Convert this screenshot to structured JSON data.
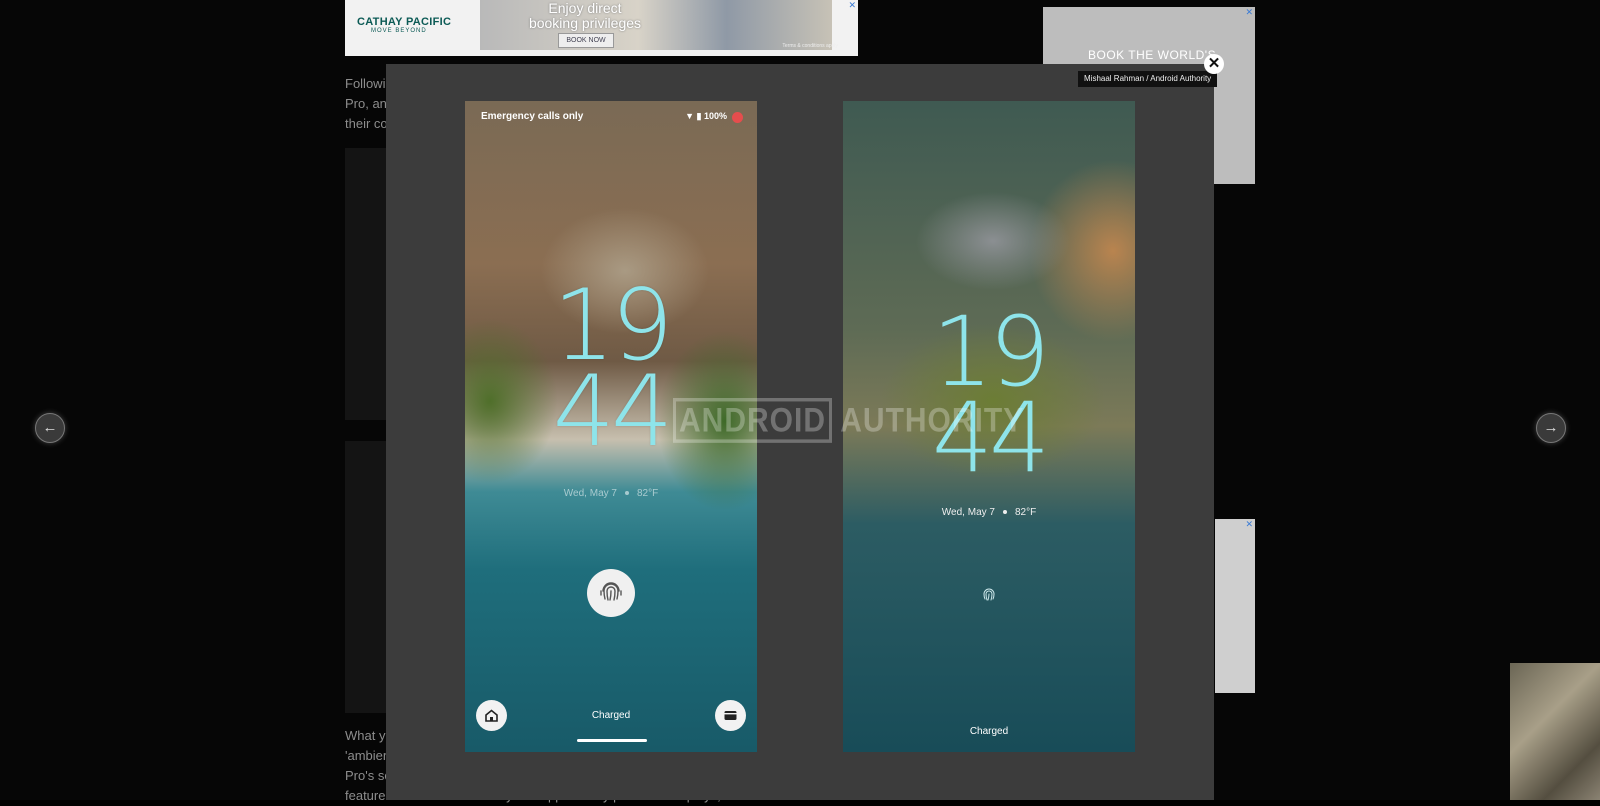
{
  "ads": {
    "top": {
      "brand": "CATHAY PACIFIC",
      "tagline": "MOVE BEYOND",
      "headline_line1": "Enjoy direct",
      "headline_line2": "booking privileges",
      "cta": "BOOK NOW",
      "terms": "Terms & conditions apply"
    },
    "right": {
      "headline": "BOOK THE WORLD'S"
    },
    "close_glyph": "✕"
  },
  "article": {
    "lines_top": [
      "Followi",
      "Pro, an",
      "their co"
    ],
    "lines_bottom": [
      "What y",
      "'ambier",
      "Pro's sc",
      "feature states that it “will only be supported by particular displays,” which could exclude current Pixel devices."
    ]
  },
  "lightbox": {
    "credit": "Mishaal Rahman / Android Authority",
    "close_icon": "✕",
    "prev_icon": "←",
    "next_icon": "→",
    "watermark_boxed": "ANDROID",
    "watermark_rest": "AUTHORITY"
  },
  "phone_left": {
    "status_text": "Emergency calls only",
    "battery": "100%",
    "time_hour": "19",
    "time_minute": "44",
    "date": "Wed, May 7",
    "temperature": "82°F",
    "bottom_status": "Charged"
  },
  "phone_right": {
    "time_hour": "19",
    "time_minute": "44",
    "date": "Wed, May 7",
    "temperature": "82°F",
    "bottom_status": "Charged"
  },
  "colors": {
    "clock": "#8ee4ea",
    "modal_bg": "#3c3c3c",
    "notification_dot": "#e54d4d"
  }
}
